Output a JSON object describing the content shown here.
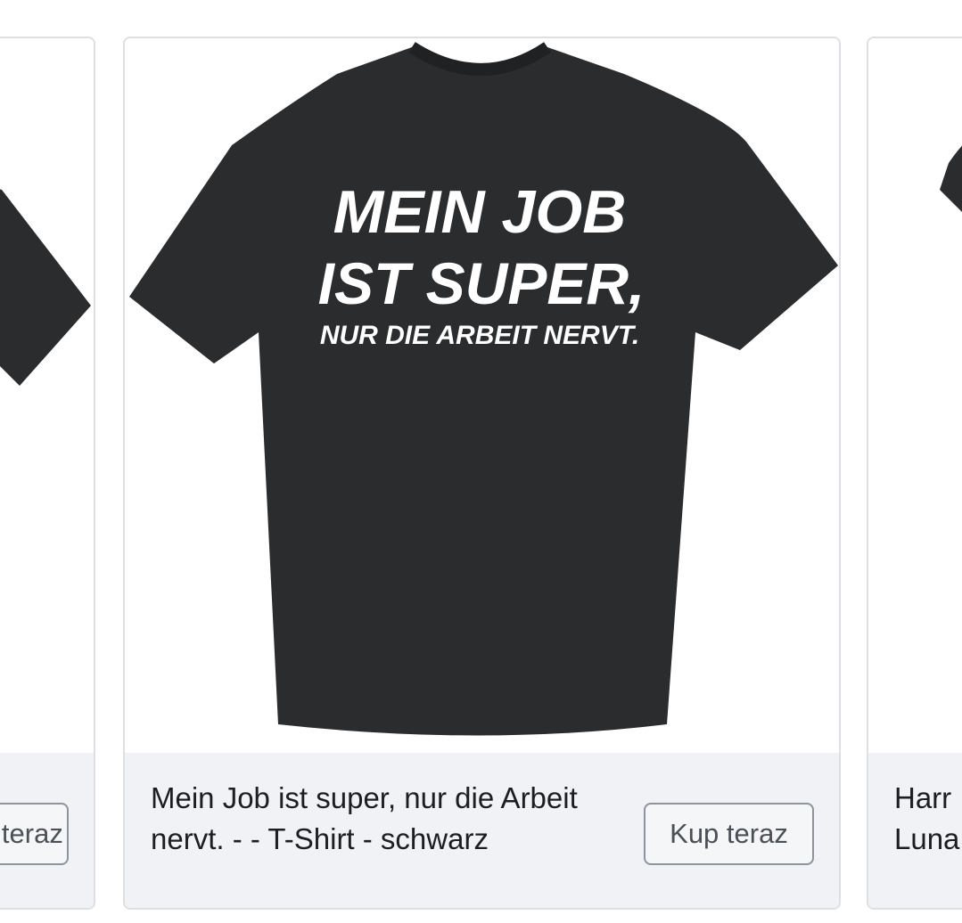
{
  "carousel": {
    "cards": [
      {
        "cta_label": "Kup teraz"
      },
      {
        "title": "Mein Job ist super, nur die Arbeit nervt. -  - T-Shirt - schwarz",
        "cta_label": "Kup teraz",
        "shirt_print": {
          "line1": "MEIN JOB",
          "line2": "IST SUPER,",
          "line3": "NUR DIE ARBEIT NERVT."
        }
      },
      {
        "title_line1": "Harr",
        "title_line2": "Luna"
      }
    ]
  },
  "colors": {
    "shirt": "#2a2c2e",
    "footer_bg": "#f0f2f5",
    "border": "#dddfe2",
    "button_border": "#8d949e"
  }
}
